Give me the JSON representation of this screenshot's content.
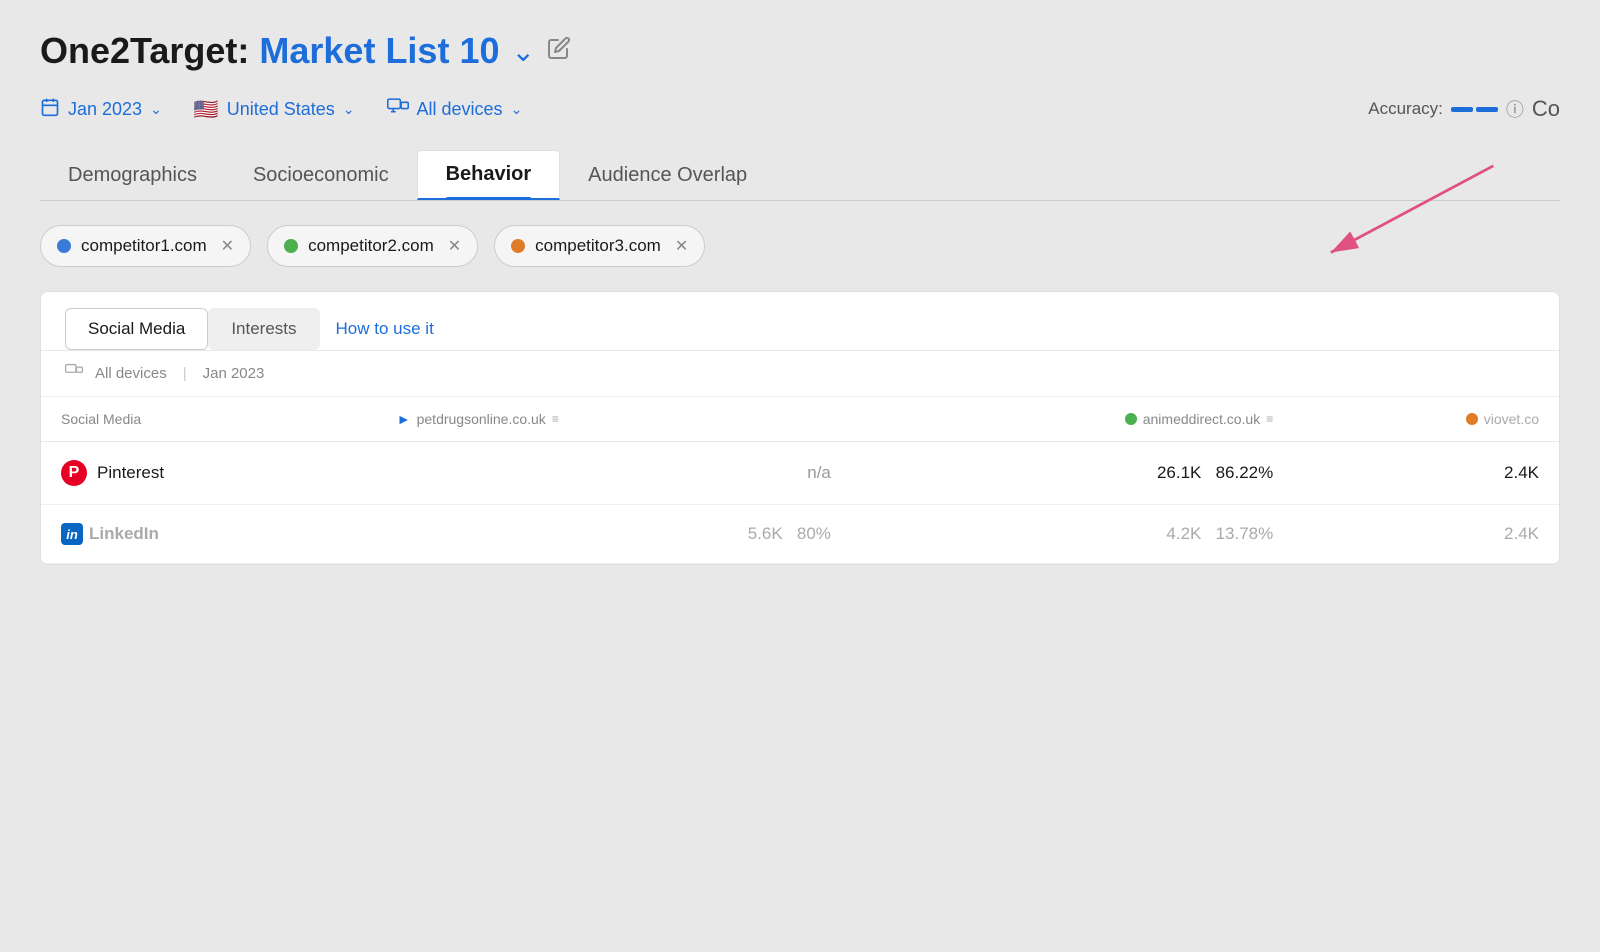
{
  "page": {
    "title_prefix": "One2Target:",
    "title_highlight": "Market List 10",
    "edit_icon": "✎"
  },
  "filters": {
    "date_label": "Jan 2023",
    "country_label": "United States",
    "devices_label": "All devices",
    "accuracy_label": "Accuracy:",
    "con_label": "Co"
  },
  "nav_tabs": [
    {
      "id": "demographics",
      "label": "Demographics"
    },
    {
      "id": "socioeconomic",
      "label": "Socioeconomic"
    },
    {
      "id": "behavior",
      "label": "Behavior",
      "active": true
    },
    {
      "id": "audience_overlap",
      "label": "Audience Overlap"
    }
  ],
  "competitors": [
    {
      "id": "comp1",
      "label": "competitor1.com",
      "color": "blue"
    },
    {
      "id": "comp2",
      "label": "competitor2.com",
      "color": "green"
    },
    {
      "id": "comp3",
      "label": "competitor3.com",
      "color": "orange"
    }
  ],
  "sub_tabs": [
    {
      "id": "social_media",
      "label": "Social Media",
      "active": true
    },
    {
      "id": "interests",
      "label": "Interests"
    }
  ],
  "how_to_label": "How to use it",
  "sub_filter": {
    "devices": "All devices",
    "date": "Jan 2023"
  },
  "table": {
    "headers": {
      "label": "Social Media",
      "col1": "petdrugsonline.co.uk",
      "col2": "animeddirect.co.uk",
      "col3": "viovet.co"
    },
    "rows": [
      {
        "id": "pinterest",
        "icon_type": "pinterest",
        "label": "Pinterest",
        "val1": "n/a",
        "val2_count": "26.1K",
        "val2_pct": "86.22%",
        "val3": "2.4K"
      },
      {
        "id": "linkedin",
        "icon_type": "linkedin",
        "label": "LinkedIn",
        "val1": "5.6K",
        "val1_pct": "80%",
        "val2_count": "4.2K",
        "val2_pct": "13.78%",
        "val3": "2.4K"
      }
    ]
  }
}
